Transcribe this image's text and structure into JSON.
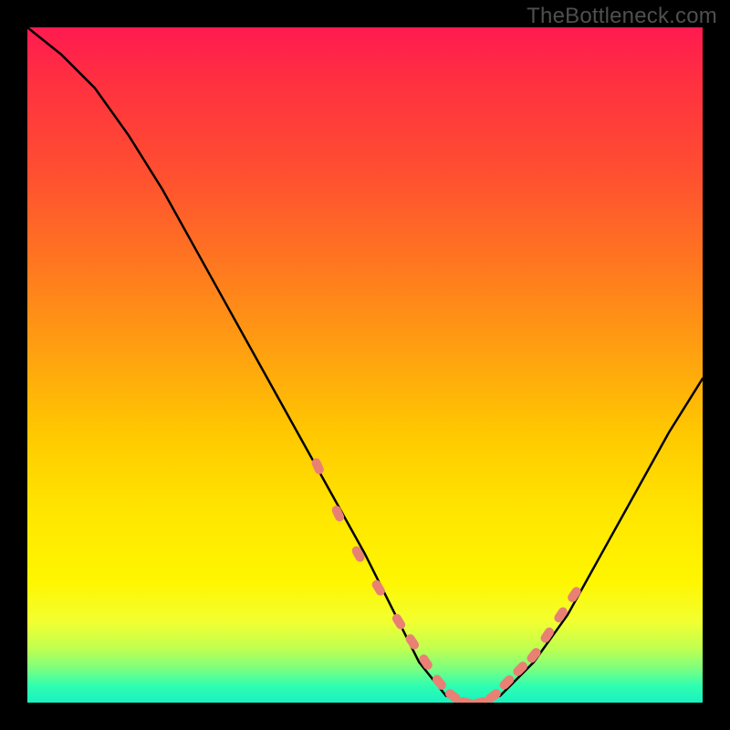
{
  "watermark": "TheBottleneck.com",
  "chart_data": {
    "type": "line",
    "title": "",
    "xlabel": "",
    "ylabel": "",
    "xlim": [
      0,
      100
    ],
    "ylim": [
      0,
      100
    ],
    "series": [
      {
        "name": "bottleneck-curve",
        "x": [
          0,
          5,
          10,
          15,
          20,
          25,
          30,
          35,
          40,
          45,
          50,
          54,
          58,
          62,
          66,
          70,
          75,
          80,
          85,
          90,
          95,
          100
        ],
        "y": [
          100,
          96,
          91,
          84,
          76,
          67,
          58,
          49,
          40,
          31,
          22,
          14,
          6,
          1,
          0,
          1,
          6,
          13,
          22,
          31,
          40,
          48
        ]
      }
    ],
    "markers": {
      "name": "highlight-points",
      "x": [
        43,
        46,
        49,
        52,
        55,
        57,
        59,
        61,
        63,
        65,
        67,
        69,
        71,
        73,
        75,
        77,
        79,
        81
      ],
      "y": [
        35,
        28,
        22,
        17,
        12,
        9,
        6,
        3,
        1,
        0,
        0,
        1,
        3,
        5,
        7,
        10,
        13,
        16
      ]
    },
    "gradient_stops": [
      {
        "pos": 0.0,
        "color": "#ff1a50"
      },
      {
        "pos": 0.22,
        "color": "#ff5030"
      },
      {
        "pos": 0.48,
        "color": "#ffa010"
      },
      {
        "pos": 0.72,
        "color": "#ffe600"
      },
      {
        "pos": 0.92,
        "color": "#c0ff50"
      },
      {
        "pos": 1.0,
        "color": "#18f0c0"
      }
    ]
  }
}
